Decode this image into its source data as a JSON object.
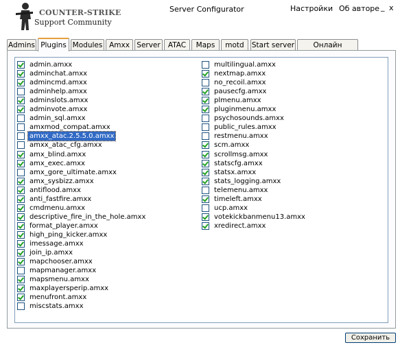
{
  "header": {
    "logo_line1": "COUNTER-STRIKE",
    "logo_line2": "Support Community",
    "title": "Server Configurator",
    "menu_settings": "Настройки",
    "menu_about": "Об авторе",
    "minimize": "_",
    "close": "x"
  },
  "tabs": [
    {
      "label": "Admins",
      "active": false
    },
    {
      "label": "Plugins",
      "active": true
    },
    {
      "label": "Modules",
      "active": false
    },
    {
      "label": "Amxx",
      "active": false
    },
    {
      "label": "Server",
      "active": false
    },
    {
      "label": "ATAC",
      "active": false
    },
    {
      "label": "Maps",
      "active": false
    },
    {
      "label": "motd",
      "active": false
    },
    {
      "label": "Start server",
      "active": false
    },
    {
      "label": "Онлайн помощь",
      "active": false
    }
  ],
  "plugins_left": [
    {
      "name": "admin.amxx",
      "checked": true
    },
    {
      "name": "adminchat.amxx",
      "checked": true
    },
    {
      "name": "admincmd.amxx",
      "checked": true
    },
    {
      "name": "adminhelp.amxx",
      "checked": false
    },
    {
      "name": "adminslots.amxx",
      "checked": true
    },
    {
      "name": "adminvote.amxx",
      "checked": true
    },
    {
      "name": "admin_sql.amxx",
      "checked": false
    },
    {
      "name": "amxmod_compat.amxx",
      "checked": false
    },
    {
      "name": "amxx_atac.2.5.5.0.amxx",
      "checked": false,
      "selected": true
    },
    {
      "name": "amxx_atac_cfg.amxx",
      "checked": false
    },
    {
      "name": "amx_blind.amxx",
      "checked": true
    },
    {
      "name": "amx_exec.amxx",
      "checked": true
    },
    {
      "name": "amx_gore_ultimate.amxx",
      "checked": false
    },
    {
      "name": "amx_sysbizz.amxx",
      "checked": true
    },
    {
      "name": "antiflood.amxx",
      "checked": true
    },
    {
      "name": "anti_fastfire.amxx",
      "checked": true
    },
    {
      "name": "cmdmenu.amxx",
      "checked": true
    },
    {
      "name": "descriptive_fire_in_the_hole.amxx",
      "checked": true
    },
    {
      "name": "format_player.amxx",
      "checked": true
    },
    {
      "name": "high_ping_kicker.amxx",
      "checked": true
    },
    {
      "name": "imessage.amxx",
      "checked": true
    },
    {
      "name": "join_ip.amxx",
      "checked": true
    },
    {
      "name": "mapchooser.amxx",
      "checked": true
    },
    {
      "name": "mapmanager.amxx",
      "checked": false
    },
    {
      "name": "mapsmenu.amxx",
      "checked": true
    },
    {
      "name": "maxplayersperip.amxx",
      "checked": true
    },
    {
      "name": "menufront.amxx",
      "checked": true
    },
    {
      "name": "miscstats.amxx",
      "checked": false
    }
  ],
  "plugins_right": [
    {
      "name": "multilingual.amxx",
      "checked": false
    },
    {
      "name": "nextmap.amxx",
      "checked": true
    },
    {
      "name": "no_recoil.amxx",
      "checked": false
    },
    {
      "name": "pausecfg.amxx",
      "checked": true
    },
    {
      "name": "plmenu.amxx",
      "checked": true
    },
    {
      "name": "pluginmenu.amxx",
      "checked": true
    },
    {
      "name": "psychosounds.amxx",
      "checked": false
    },
    {
      "name": "public_rules.amxx",
      "checked": false
    },
    {
      "name": "restmenu.amxx",
      "checked": false
    },
    {
      "name": "scm.amxx",
      "checked": true
    },
    {
      "name": "scrollmsg.amxx",
      "checked": true
    },
    {
      "name": "statscfg.amxx",
      "checked": true
    },
    {
      "name": "statsx.amxx",
      "checked": true
    },
    {
      "name": "stats_logging.amxx",
      "checked": true
    },
    {
      "name": "telemenu.amxx",
      "checked": false
    },
    {
      "name": "timeleft.amxx",
      "checked": true
    },
    {
      "name": "ucp.amxx",
      "checked": false
    },
    {
      "name": "votekickbanmenu13.amxx",
      "checked": true
    },
    {
      "name": "xredirect.amxx",
      "checked": true
    }
  ],
  "footer": {
    "save_label": "Сохранить"
  }
}
